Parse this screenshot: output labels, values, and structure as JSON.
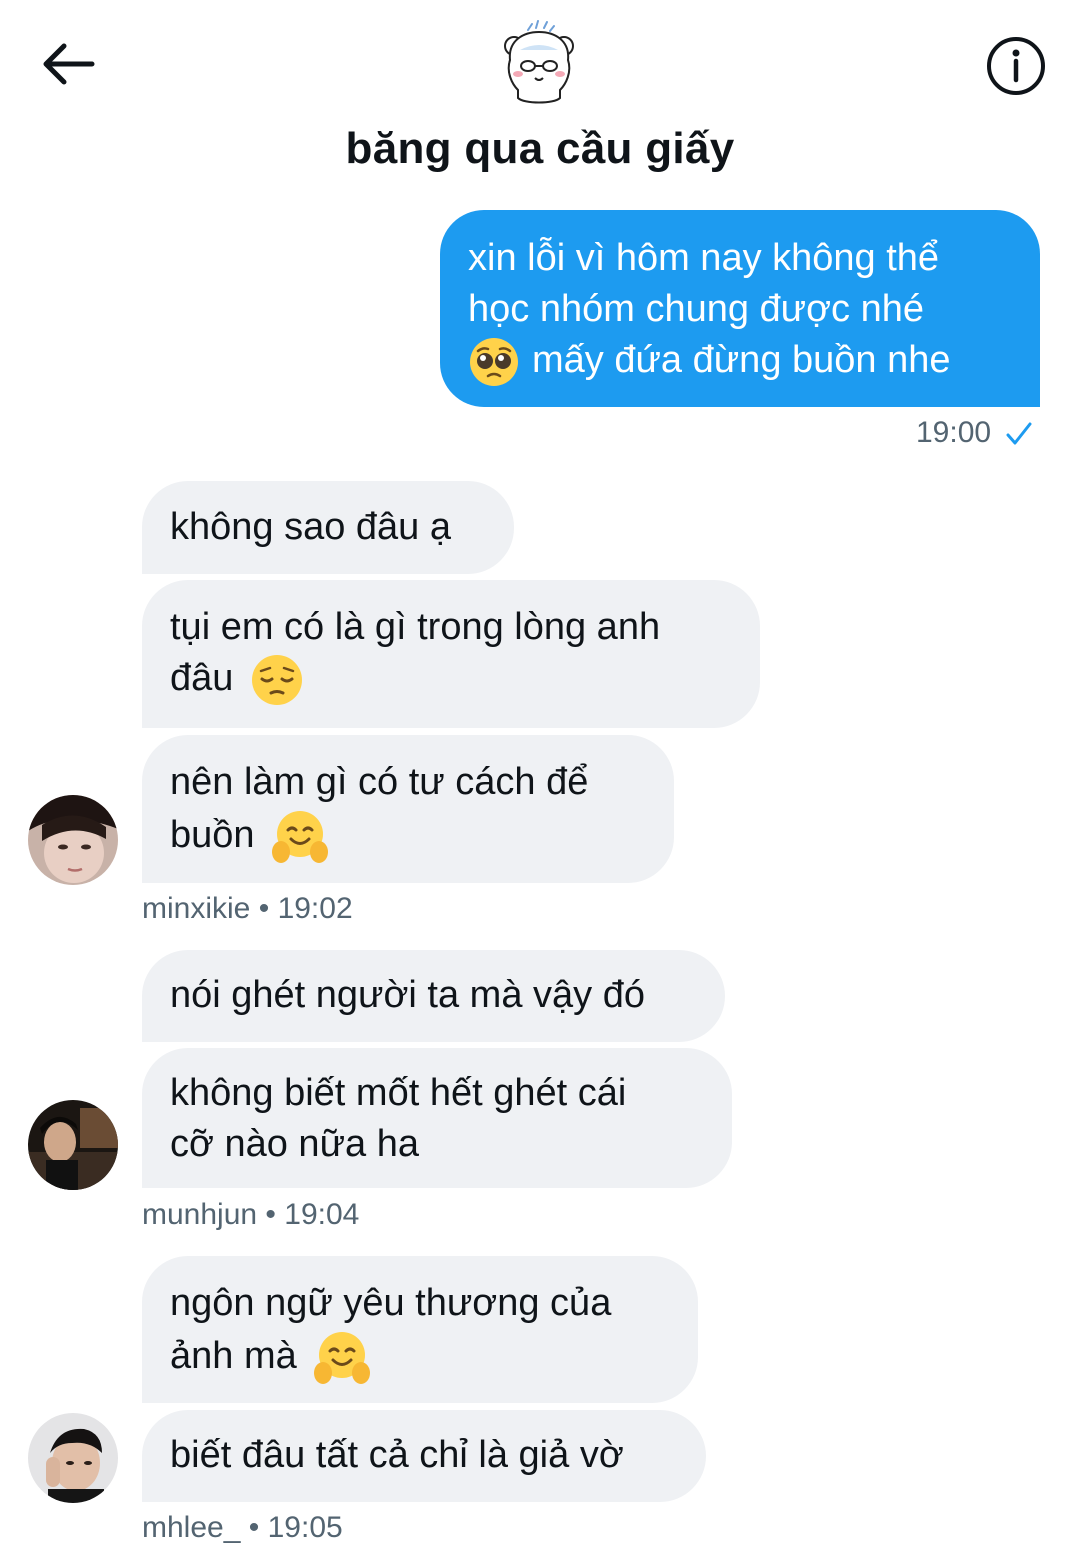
{
  "header": {
    "title": "băng qua cầu giấy",
    "back_icon": "arrow-left-icon",
    "info_icon": "info-circle-icon",
    "group_avatar_icon": "bear-avatar-icon"
  },
  "colors": {
    "outgoing_bubble": "#1d9bf0",
    "incoming_bubble": "#eff1f4",
    "meta_text": "#536471"
  },
  "outgoing": {
    "lines": [
      "xin lỗi vì hôm nay không thể",
      "học nhóm chung được nhé",
      "mấy đứa đừng buồn nhe"
    ],
    "emoji": "pleading-face-emoji",
    "time": "19:00",
    "status_icon": "sent-check-icon"
  },
  "groups": [
    {
      "sender": "minxikie",
      "time": "19:02",
      "bubbles": [
        {
          "lines": [
            "không sao đâu ạ"
          ]
        },
        {
          "lines": [
            "tụi em có là gì trong lòng anh",
            "đâu"
          ],
          "emoji": "pensive-face-emoji"
        },
        {
          "lines": [
            "nên làm gì có tư cách để",
            "buồn"
          ],
          "emoji": "hugging-face-emoji"
        }
      ]
    },
    {
      "sender": "munhjun",
      "time": "19:04",
      "bubbles": [
        {
          "lines": [
            "nói ghét người ta mà vậy đó"
          ]
        },
        {
          "lines": [
            "không biết mốt hết ghét cái",
            "cỡ nào nữa ha"
          ]
        }
      ]
    },
    {
      "sender": "mhlee_",
      "time": "19:05",
      "bubbles": [
        {
          "lines": [
            "ngôn ngữ yêu thương của",
            "ảnh mà"
          ],
          "emoji": "hugging-face-emoji"
        },
        {
          "lines": [
            "biết đâu tất cả chỉ là giả vờ"
          ]
        }
      ]
    }
  ],
  "separator": "•"
}
